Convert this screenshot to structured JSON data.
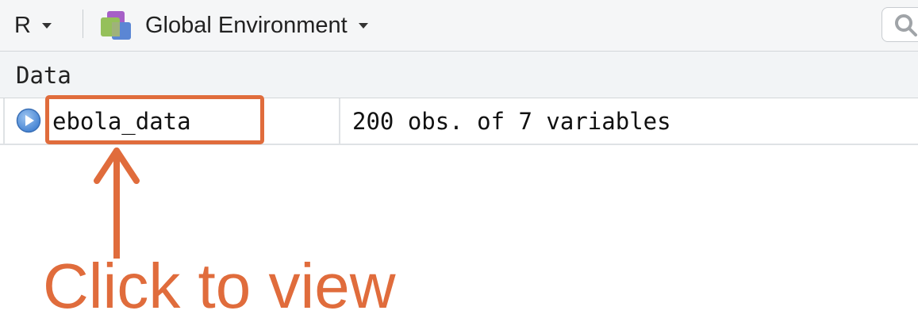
{
  "toolbar": {
    "language": "R",
    "environment": "Global Environment",
    "search_icon": "search-icon"
  },
  "environment_pane": {
    "section_title": "Data",
    "rows": [
      {
        "name": "ebola_data",
        "value": "200 obs. of 7 variables",
        "icon": "expand-arrow-icon"
      }
    ]
  },
  "annotation": {
    "text": "Click to view",
    "color": "#e06c3c"
  }
}
